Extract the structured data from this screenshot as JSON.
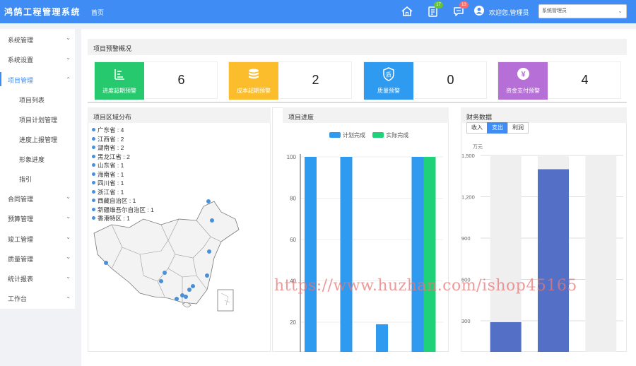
{
  "app": {
    "title": "鸿鹄工程管理系统",
    "home": "首页"
  },
  "header": {
    "badge_todo": "17",
    "badge_msg": "13",
    "welcome": "欢迎您,管理员",
    "role_select": "系统管理员",
    "badge_color_todo": "#67c23a",
    "badge_color_msg": "#f56c6c"
  },
  "sidebar": {
    "items": [
      {
        "label": "系统管理"
      },
      {
        "label": "系统设置"
      },
      {
        "label": "项目管理"
      },
      {
        "label": "项目列表"
      },
      {
        "label": "项目计划管理"
      },
      {
        "label": "进度上报管理"
      },
      {
        "label": "形象进度"
      },
      {
        "label": "指引"
      },
      {
        "label": "合同管理"
      },
      {
        "label": "预算管理"
      },
      {
        "label": "竣工管理"
      },
      {
        "label": "质量管理"
      },
      {
        "label": "统计报表"
      },
      {
        "label": "工作台"
      }
    ]
  },
  "overview": {
    "title": "项目预警概况",
    "cards": [
      {
        "label": "进度超期预警",
        "value": "6",
        "color": "#27c96e",
        "icon": "progress-chart-icon"
      },
      {
        "label": "成本超期预警",
        "value": "2",
        "color": "#fbbd2c",
        "icon": "coin-stack-icon"
      },
      {
        "label": "质量预警",
        "value": "0",
        "color": "#2e9bf0",
        "icon": "quality-shield-icon"
      },
      {
        "label": "资金支付预警",
        "value": "4",
        "color": "#b66fd6",
        "icon": "yen-coin-icon"
      }
    ]
  },
  "region": {
    "title": "项目区域分布",
    "items": [
      {
        "label": "广东省 : 4"
      },
      {
        "label": "江西省 : 2"
      },
      {
        "label": "湖南省 : 2"
      },
      {
        "label": "黑龙江省 : 2"
      },
      {
        "label": "山东省 : 1"
      },
      {
        "label": "海南省 : 1"
      },
      {
        "label": "四川省 : 1"
      },
      {
        "label": "浙江省 : 1"
      },
      {
        "label": "西藏自治区 : 1"
      },
      {
        "label": "新疆维吾尔自治区 : 1"
      },
      {
        "label": "香港特区 : 1"
      }
    ]
  },
  "progress": {
    "title": "项目进度",
    "chart_data": {
      "type": "bar",
      "series": [
        {
          "name": "计划完成",
          "values": [
            100,
            100,
            19,
            100
          ],
          "color": "#2e9bf0"
        },
        {
          "name": "实际完成",
          "values": [
            null,
            null,
            null,
            100
          ],
          "color": "#1fd27a"
        }
      ],
      "yticks": [
        "100",
        "80",
        "60",
        "40",
        "20"
      ],
      "ylim": [
        0,
        100
      ],
      "legend_position": "top"
    }
  },
  "finance": {
    "title": "财务数据",
    "tabs": [
      {
        "label": "收入"
      },
      {
        "label": "支出"
      },
      {
        "label": "利润"
      }
    ],
    "unit": "万元",
    "chart_data": {
      "type": "bar",
      "yticks": [
        "1,500",
        "1,200",
        "900",
        "600",
        "300"
      ],
      "values": [
        290,
        1400,
        null
      ],
      "ylim": [
        0,
        1500
      ],
      "color": "#5470c6"
    }
  },
  "watermark": "https://www.huzhan.com/ishop45165"
}
